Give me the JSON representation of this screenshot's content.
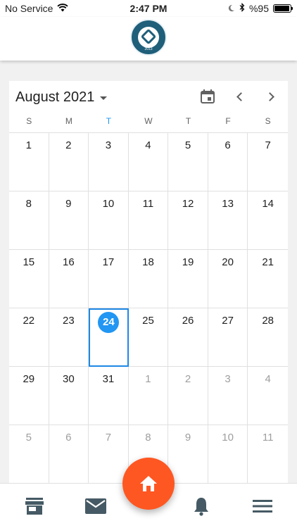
{
  "status_bar": {
    "carrier": "No Service",
    "time": "2:47 PM",
    "battery_percent": "%95",
    "battery_level": 0.95
  },
  "header": {
    "logo_text": "2013"
  },
  "calendar": {
    "month_title": "August 2021",
    "weekdays": [
      "S",
      "M",
      "T",
      "W",
      "T",
      "F",
      "S"
    ],
    "today_weekday_index": 2,
    "weeks": [
      [
        {
          "n": "1"
        },
        {
          "n": "2"
        },
        {
          "n": "3"
        },
        {
          "n": "4"
        },
        {
          "n": "5"
        },
        {
          "n": "6"
        },
        {
          "n": "7"
        }
      ],
      [
        {
          "n": "8"
        },
        {
          "n": "9"
        },
        {
          "n": "10"
        },
        {
          "n": "11"
        },
        {
          "n": "12"
        },
        {
          "n": "13"
        },
        {
          "n": "14"
        }
      ],
      [
        {
          "n": "15"
        },
        {
          "n": "16"
        },
        {
          "n": "17"
        },
        {
          "n": "18"
        },
        {
          "n": "19"
        },
        {
          "n": "20"
        },
        {
          "n": "21"
        }
      ],
      [
        {
          "n": "22"
        },
        {
          "n": "23"
        },
        {
          "n": "24",
          "selected": true
        },
        {
          "n": "25"
        },
        {
          "n": "26"
        },
        {
          "n": "27"
        },
        {
          "n": "28"
        }
      ],
      [
        {
          "n": "29"
        },
        {
          "n": "30"
        },
        {
          "n": "31"
        },
        {
          "n": "1",
          "other": true
        },
        {
          "n": "2",
          "other": true
        },
        {
          "n": "3",
          "other": true
        },
        {
          "n": "4",
          "other": true
        }
      ],
      [
        {
          "n": "5",
          "other": true
        },
        {
          "n": "6",
          "other": true
        },
        {
          "n": "7",
          "other": true
        },
        {
          "n": "8",
          "other": true
        },
        {
          "n": "9",
          "other": true
        },
        {
          "n": "10",
          "other": true
        },
        {
          "n": "11",
          "other": true
        }
      ]
    ]
  },
  "bottom_nav": {
    "items": [
      "store-icon",
      "mail-icon",
      "home-icon",
      "bell-icon",
      "menu-icon"
    ]
  },
  "colors": {
    "accent": "#2196f3",
    "fab": "#ff5722",
    "header_icon": "#616161",
    "nav_icon": "#455a64"
  }
}
